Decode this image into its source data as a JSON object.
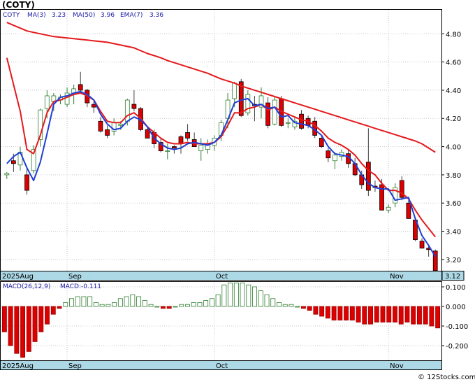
{
  "chart_data": [
    {
      "type": "candlestick",
      "title": "(COTY)",
      "legend": {
        "symbol": "COTY",
        "ma_short_label": "MA(3)",
        "ma_short_value": "3.23",
        "ma_long_label": "MA(50)",
        "ma_long_value": "3.96",
        "ema_label": "EMA(7)",
        "ema_value": "3.36"
      },
      "y_ticks": [
        "4.80",
        "4.60",
        "4.40",
        "4.20",
        "4.00",
        "3.80",
        "3.60",
        "3.40",
        "3.20"
      ],
      "ylim": [
        3.12,
        4.97
      ],
      "x_labels": [
        {
          "label": "2025Aug",
          "index": 0
        },
        {
          "label": "Sep",
          "index": 9
        },
        {
          "label": "Oct",
          "index": 31
        },
        {
          "label": "Nov",
          "index": 57
        }
      ],
      "last_price": "3.12",
      "candles": [
        [
          3.8,
          3.82,
          3.77,
          3.81
        ],
        [
          3.9,
          3.95,
          3.82,
          3.88
        ],
        [
          3.87,
          4.0,
          3.83,
          3.96
        ],
        [
          3.8,
          3.85,
          3.66,
          3.69
        ],
        [
          3.83,
          4.01,
          3.81,
          3.98
        ],
        [
          4.05,
          4.27,
          4.0,
          4.26
        ],
        [
          4.27,
          4.4,
          4.2,
          4.36
        ],
        [
          4.32,
          4.38,
          4.25,
          4.36
        ],
        [
          4.33,
          4.37,
          4.3,
          4.35
        ],
        [
          4.3,
          4.42,
          4.28,
          4.38
        ],
        [
          4.38,
          4.44,
          4.3,
          4.41
        ],
        [
          4.44,
          4.53,
          4.38,
          4.4
        ],
        [
          4.4,
          4.41,
          4.28,
          4.31
        ],
        [
          4.3,
          4.33,
          4.24,
          4.28
        ],
        [
          4.18,
          4.21,
          4.1,
          4.11
        ],
        [
          4.12,
          4.15,
          4.06,
          4.08
        ],
        [
          4.11,
          4.2,
          4.08,
          4.17
        ],
        [
          4.15,
          4.18,
          4.12,
          4.16
        ],
        [
          4.18,
          4.34,
          4.15,
          4.33
        ],
        [
          4.3,
          4.4,
          4.25,
          4.27
        ],
        [
          4.27,
          4.28,
          4.11,
          4.12
        ],
        [
          4.12,
          4.14,
          4.06,
          4.06
        ],
        [
          4.1,
          4.12,
          3.99,
          4.02
        ],
        [
          4.03,
          4.06,
          3.96,
          3.97
        ],
        [
          3.97,
          4.02,
          3.91,
          3.97
        ],
        [
          4.0,
          4.01,
          3.95,
          3.99
        ],
        [
          4.07,
          4.08,
          3.95,
          4.02
        ],
        [
          4.1,
          4.16,
          4.04,
          4.06
        ],
        [
          4.05,
          4.1,
          4.0,
          4.0
        ],
        [
          3.97,
          4.06,
          3.9,
          4.01
        ],
        [
          3.98,
          4.05,
          3.95,
          4.02
        ],
        [
          4.01,
          4.08,
          3.97,
          4.06
        ],
        [
          4.08,
          4.19,
          4.04,
          4.17
        ],
        [
          4.2,
          4.38,
          4.13,
          4.33
        ],
        [
          4.34,
          4.46,
          4.28,
          4.45
        ],
        [
          4.46,
          4.48,
          4.21,
          4.22
        ],
        [
          4.24,
          4.4,
          4.22,
          4.37
        ],
        [
          4.3,
          4.36,
          4.18,
          4.29
        ],
        [
          4.28,
          4.42,
          4.2,
          4.36
        ],
        [
          4.31,
          4.35,
          4.13,
          4.15
        ],
        [
          4.16,
          4.35,
          4.15,
          4.33
        ],
        [
          4.34,
          4.36,
          4.14,
          4.15
        ],
        [
          4.17,
          4.2,
          4.13,
          4.17
        ],
        [
          4.14,
          4.21,
          4.12,
          4.18
        ],
        [
          4.23,
          4.26,
          4.12,
          4.13
        ],
        [
          4.2,
          4.22,
          4.13,
          4.15
        ],
        [
          4.18,
          4.21,
          4.06,
          4.08
        ],
        [
          4.06,
          4.08,
          3.99,
          4.0
        ],
        [
          3.97,
          3.99,
          3.89,
          3.92
        ],
        [
          3.9,
          3.96,
          3.84,
          3.94
        ],
        [
          3.93,
          3.98,
          3.9,
          3.96
        ],
        [
          3.95,
          3.98,
          3.85,
          3.88
        ],
        [
          3.88,
          3.92,
          3.79,
          3.8
        ],
        [
          3.8,
          3.83,
          3.7,
          3.73
        ],
        [
          3.89,
          4.13,
          3.65,
          3.69
        ],
        [
          3.72,
          3.76,
          3.68,
          3.71
        ],
        [
          3.73,
          3.77,
          3.55,
          3.55
        ],
        [
          3.55,
          3.59,
          3.53,
          3.57
        ],
        [
          3.6,
          3.74,
          3.57,
          3.71
        ],
        [
          3.76,
          3.79,
          3.62,
          3.64
        ],
        [
          3.6,
          3.62,
          3.49,
          3.49
        ],
        [
          3.48,
          3.5,
          3.33,
          3.34
        ],
        [
          3.33,
          3.35,
          3.28,
          3.28
        ],
        [
          3.28,
          3.3,
          3.22,
          3.27
        ],
        [
          3.26,
          3.27,
          3.12,
          3.12
        ]
      ],
      "ma_short": [
        3.88,
        3.93,
        3.96,
        3.85,
        3.76,
        3.89,
        4.09,
        4.3,
        4.35,
        4.36,
        4.38,
        4.39,
        4.37,
        4.33,
        4.23,
        4.16,
        4.12,
        4.13,
        4.18,
        4.21,
        4.19,
        4.14,
        4.06,
        4.02,
        3.99,
        3.98,
        3.99,
        4.02,
        4.03,
        4.02,
        4.01,
        4.03,
        4.08,
        4.19,
        4.31,
        4.33,
        4.34,
        4.29,
        4.3,
        4.27,
        4.28,
        4.21,
        4.22,
        4.17,
        4.16,
        4.15,
        4.12,
        4.08,
        4.0,
        3.95,
        3.94,
        3.93,
        3.88,
        3.8,
        3.74,
        3.71,
        3.7,
        3.7,
        3.62,
        3.63,
        3.64,
        3.49,
        3.37,
        3.3,
        3.22
      ],
      "ma_long": [
        4.88,
        4.86,
        4.84,
        4.82,
        4.81,
        4.8,
        4.79,
        4.78,
        4.775,
        4.77,
        4.765,
        4.76,
        4.755,
        4.75,
        4.745,
        4.74,
        4.73,
        4.72,
        4.71,
        4.7,
        4.68,
        4.66,
        4.645,
        4.63,
        4.61,
        4.595,
        4.58,
        4.565,
        4.55,
        4.535,
        4.52,
        4.5,
        4.48,
        4.465,
        4.45,
        4.43,
        4.415,
        4.4,
        4.385,
        4.37,
        4.355,
        4.34,
        4.325,
        4.31,
        4.295,
        4.28,
        4.265,
        4.25,
        4.235,
        4.22,
        4.205,
        4.19,
        4.175,
        4.16,
        4.145,
        4.13,
        4.115,
        4.1,
        4.085,
        4.07,
        4.055,
        4.04,
        4.02,
        3.99,
        3.96
      ],
      "ema": [
        4.63,
        4.44,
        4.25,
        3.98,
        3.95,
        4.08,
        4.24,
        4.32,
        4.33,
        4.35,
        4.37,
        4.38,
        4.36,
        4.33,
        4.25,
        4.18,
        4.17,
        4.17,
        4.22,
        4.24,
        4.2,
        4.14,
        4.1,
        4.06,
        4.03,
        4.02,
        4.02,
        4.03,
        4.02,
        4.02,
        4.02,
        4.03,
        4.07,
        4.15,
        4.24,
        4.24,
        4.27,
        4.28,
        4.3,
        4.26,
        4.28,
        4.25,
        4.23,
        4.21,
        4.19,
        4.18,
        4.15,
        4.11,
        4.06,
        4.03,
        4.01,
        3.98,
        3.94,
        3.88,
        3.83,
        3.8,
        3.74,
        3.69,
        3.69,
        3.67,
        3.63,
        3.55,
        3.48,
        3.42,
        3.36
      ]
    },
    {
      "type": "bar",
      "title": "MACD(26,12,9)",
      "value_label": "MACD:-0.111",
      "y_ticks": [
        "0.100",
        "0.000",
        "-0.100",
        "-0.200"
      ],
      "ylim": [
        -0.275,
        0.125
      ],
      "values": [
        -0.13,
        -0.2,
        -0.24,
        -0.26,
        -0.23,
        -0.18,
        -0.13,
        -0.09,
        -0.04,
        -0.01,
        0.02,
        0.04,
        0.05,
        0.05,
        0.05,
        0.02,
        0.01,
        0.01,
        0.02,
        0.04,
        0.05,
        0.06,
        0.05,
        0.03,
        0.01,
        0.0,
        -0.01,
        -0.01,
        0.0,
        0.01,
        0.01,
        0.02,
        0.02,
        0.03,
        0.04,
        0.06,
        0.11,
        0.12,
        0.12,
        0.12,
        0.11,
        0.1,
        0.08,
        0.06,
        0.04,
        0.02,
        0.01,
        0.01,
        0.0,
        -0.01,
        -0.02,
        -0.04,
        -0.05,
        -0.06,
        -0.07,
        -0.07,
        -0.07,
        -0.07,
        -0.08,
        -0.09,
        -0.09,
        -0.08,
        -0.08,
        -0.08,
        -0.08,
        -0.09,
        -0.08,
        -0.09,
        -0.09,
        -0.09,
        -0.1,
        -0.11
      ]
    }
  ],
  "watermark": "© 12Stocks.com"
}
